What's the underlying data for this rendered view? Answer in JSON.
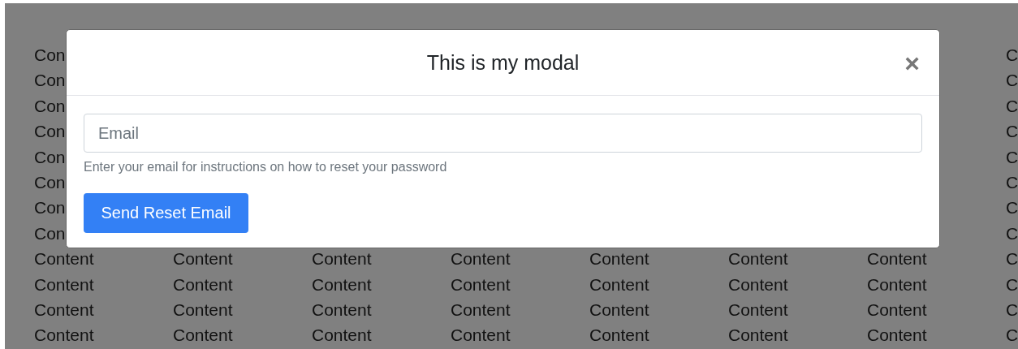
{
  "background_rows": [
    {
      "cells": [
        "Con",
        "C"
      ]
    },
    {
      "cells": [
        "Con",
        "C"
      ]
    },
    {
      "cells": [
        "Con",
        "C"
      ]
    },
    {
      "cells": [
        "Con",
        "C"
      ]
    },
    {
      "cells": [
        "Con",
        "C"
      ]
    },
    {
      "cells": [
        "Con",
        "C"
      ]
    },
    {
      "cells": [
        "Con",
        "C"
      ]
    },
    {
      "cells": [
        "Con",
        "C"
      ]
    },
    {
      "cells": [
        "Content",
        "Content",
        "Content",
        "Content",
        "Content",
        "Content",
        "Content",
        "C"
      ]
    },
    {
      "cells": [
        "Content",
        "Content",
        "Content",
        "Content",
        "Content",
        "Content",
        "Content",
        "C"
      ]
    },
    {
      "cells": [
        "Content",
        "Content",
        "Content",
        "Content",
        "Content",
        "Content",
        "Content",
        "C"
      ]
    },
    {
      "cells": [
        "Content",
        "Content",
        "Content",
        "Content",
        "Content",
        "Content",
        "Content",
        "C"
      ]
    }
  ],
  "modal": {
    "title": "This is my modal",
    "close": "×",
    "email_field": {
      "placeholder": "Email"
    },
    "help_text": "Enter your email for instructions on how to reset your password",
    "submit_button": "Send Reset Email"
  }
}
